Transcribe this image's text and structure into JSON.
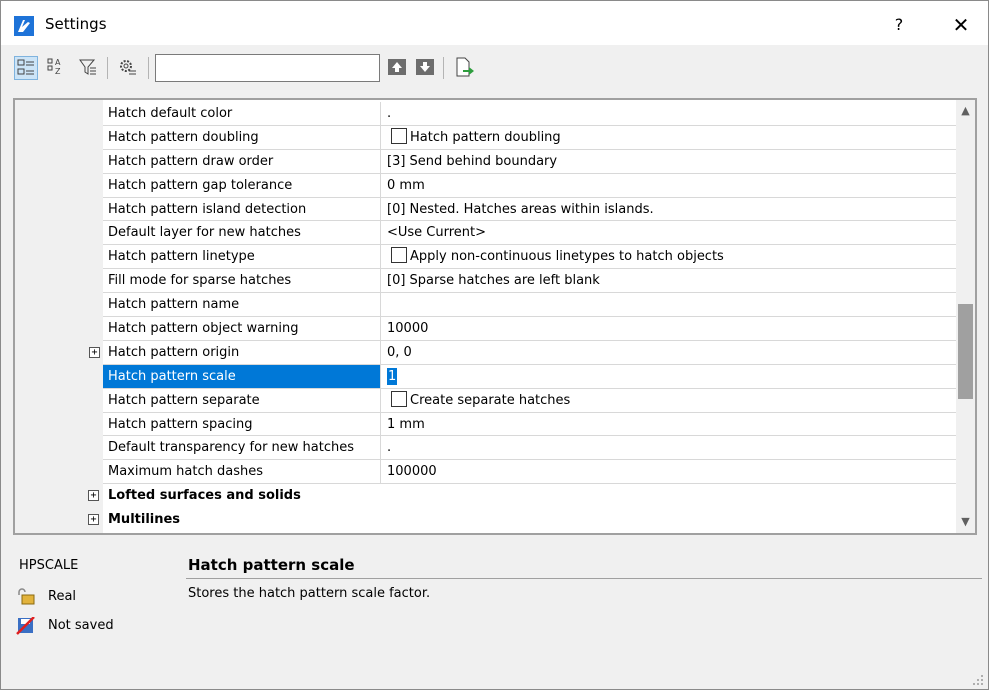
{
  "window": {
    "title": "Settings",
    "help_label": "?",
    "close_label": "✕"
  },
  "toolbar": {
    "search_value": "",
    "buttons": [
      "categorized-view",
      "alphabetical-view",
      "filter",
      "settings-gear",
      "previous",
      "next",
      "export"
    ]
  },
  "grid": {
    "rows": [
      {
        "name": "Hatch default color",
        "value": ".",
        "type": "text"
      },
      {
        "name": "Hatch pattern doubling",
        "value": "Hatch pattern doubling",
        "type": "checkbox"
      },
      {
        "name": "Hatch pattern draw order",
        "value": "[3] Send behind boundary",
        "type": "text"
      },
      {
        "name": "Hatch pattern gap tolerance",
        "value": "0 mm",
        "type": "text"
      },
      {
        "name": "Hatch pattern island detection",
        "value": "[0] Nested. Hatches areas within islands.",
        "type": "text"
      },
      {
        "name": "Default layer for new hatches",
        "value": "<Use Current>",
        "type": "text"
      },
      {
        "name": "Hatch pattern linetype",
        "value": "Apply non-continuous linetypes to hatch objects",
        "type": "checkbox"
      },
      {
        "name": "Fill mode for sparse hatches",
        "value": "[0] Sparse hatches are left blank",
        "type": "text"
      },
      {
        "name": "Hatch pattern name",
        "value": "",
        "type": "text"
      },
      {
        "name": "Hatch pattern object warning",
        "value": "10000",
        "type": "text"
      },
      {
        "name": "Hatch pattern origin",
        "value": "0, 0",
        "type": "expandable"
      },
      {
        "name": "Hatch pattern scale",
        "value": "1",
        "type": "edit"
      },
      {
        "name": "Hatch pattern separate",
        "value": "Create separate hatches",
        "type": "checkbox"
      },
      {
        "name": "Hatch pattern spacing",
        "value": "1 mm",
        "type": "text"
      },
      {
        "name": "Default transparency for new hatches",
        "value": ".",
        "type": "text"
      },
      {
        "name": "Maximum hatch dashes",
        "value": "100000",
        "type": "text"
      }
    ],
    "categories": [
      {
        "name": "Lofted surfaces and solids",
        "expander": "+"
      },
      {
        "name": "Multilines",
        "expander": "+"
      }
    ],
    "selected_row": "Hatch pattern scale",
    "expander_symbol": "+"
  },
  "description": {
    "key": "HPSCALE",
    "type": "Real",
    "saved": "Not saved",
    "title": "Hatch pattern scale",
    "text": "Stores the hatch pattern scale factor."
  },
  "colors": {
    "selection": "#0078d7",
    "logo": "#1e73d8"
  }
}
